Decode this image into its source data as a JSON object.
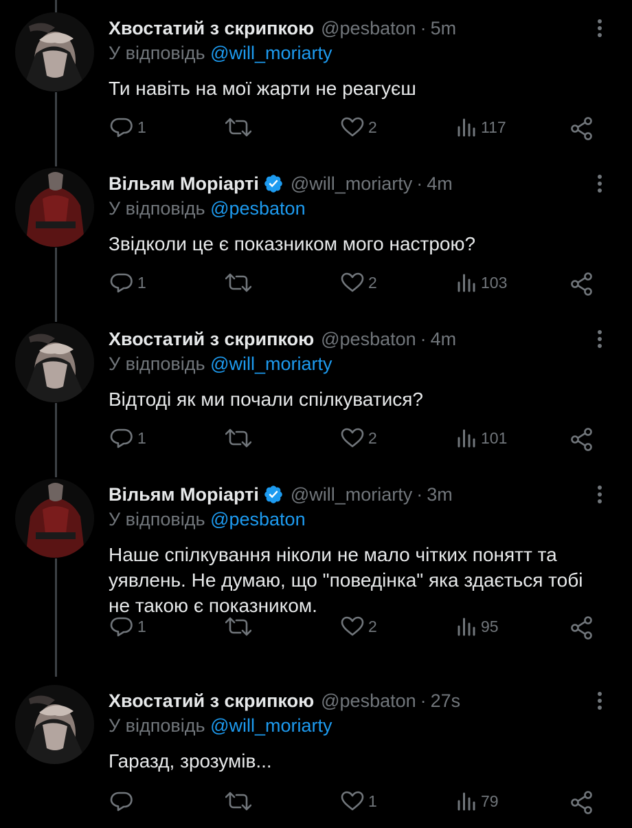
{
  "colors": {
    "background": "#000000",
    "text": "#e7e9ea",
    "muted": "#71767b",
    "link": "#1d9bf0",
    "verified": "#1d9bf0",
    "thread_line": "#3d4146"
  },
  "reply_prefix": "У відповідь",
  "tweets": [
    {
      "author": "Хвостатий з скрипкою",
      "handle": "@pesbaton",
      "time": "5m",
      "verified": false,
      "reply_to": "@will_moriarty",
      "text": "Ти навіть на мої жарти не реагуєш",
      "replies": "1",
      "retweets": "",
      "likes": "2",
      "views": "117"
    },
    {
      "author": "Вільям Моріарті",
      "handle": "@will_moriarty",
      "time": "4m",
      "verified": true,
      "reply_to": "@pesbaton",
      "text": "Звідколи це є показником мого настрою?",
      "replies": "1",
      "retweets": "",
      "likes": "2",
      "views": "103"
    },
    {
      "author": "Хвостатий з скрипкою",
      "handle": "@pesbaton",
      "time": "4m",
      "verified": false,
      "reply_to": "@will_moriarty",
      "text": "Відтоді як ми почали спілкуватися?",
      "replies": "1",
      "retweets": "",
      "likes": "2",
      "views": "101"
    },
    {
      "author": "Вільям Моріарті",
      "handle": "@will_moriarty",
      "time": "3m",
      "verified": true,
      "reply_to": "@pesbaton",
      "text": "Наше спілкування ніколи не мало чітких понятт та уявлень. Не думаю, що \"поведінка\" яка здається тобі не такою є показником.",
      "replies": "1",
      "retweets": "",
      "likes": "2",
      "views": "95"
    },
    {
      "author": "Хвостатий з скрипкою",
      "handle": "@pesbaton",
      "time": "27s",
      "verified": false,
      "reply_to": "@will_moriarty",
      "text": "Гаразд, зрозумів...",
      "replies": "",
      "retweets": "",
      "likes": "1",
      "views": "79"
    }
  ],
  "icons": [
    "more-icon",
    "verified-icon",
    "reply-icon",
    "retweet-icon",
    "like-icon",
    "views-icon",
    "share-icon"
  ]
}
